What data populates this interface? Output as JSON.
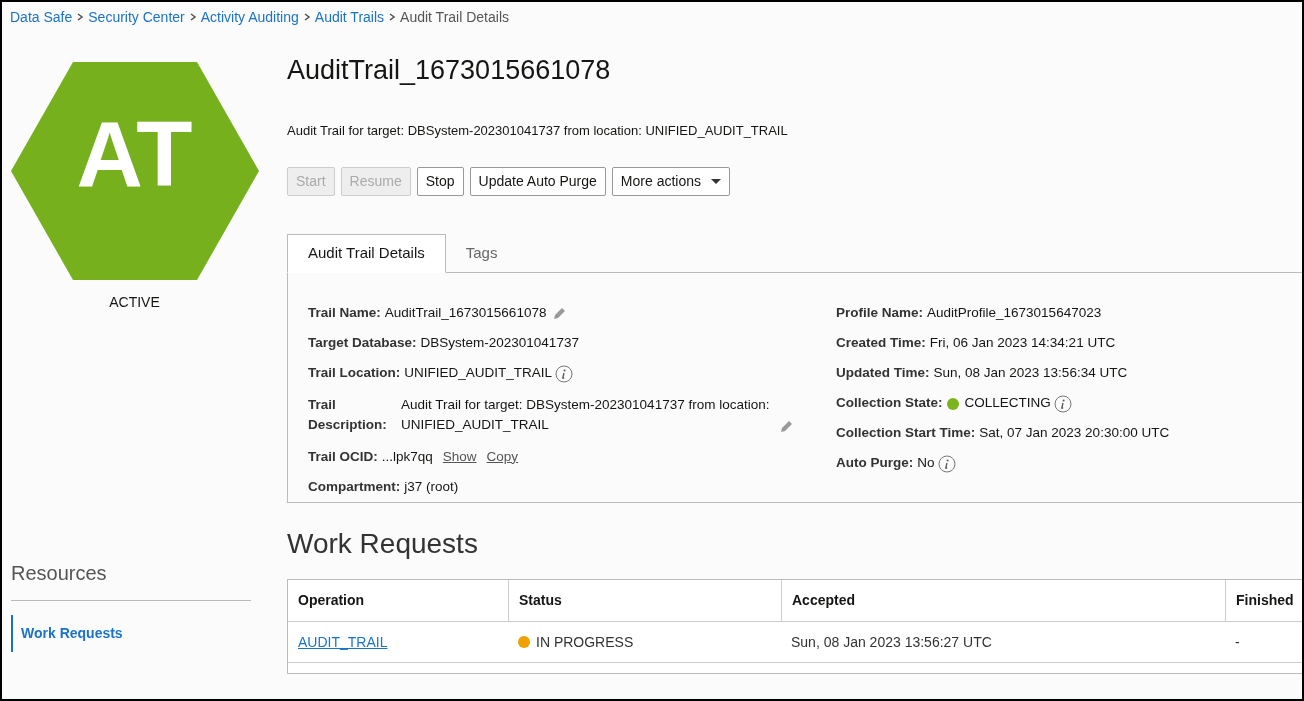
{
  "breadcrumbs": [
    {
      "label": "Data Safe",
      "link": true
    },
    {
      "label": "Security Center",
      "link": true
    },
    {
      "label": "Activity Auditing",
      "link": true
    },
    {
      "label": "Audit Trails",
      "link": true
    },
    {
      "label": "Audit Trail Details",
      "link": false
    }
  ],
  "badge": {
    "initials": "AT",
    "state": "ACTIVE"
  },
  "title": "AuditTrail_1673015661078",
  "subtitle": "Audit Trail for target: DBSystem-202301041737 from location: UNIFIED_AUDIT_TRAIL",
  "actions": [
    {
      "label": "Start",
      "disabled": true,
      "dropdown": false
    },
    {
      "label": "Resume",
      "disabled": true,
      "dropdown": false
    },
    {
      "label": "Stop",
      "disabled": false,
      "dropdown": false
    },
    {
      "label": "Update Auto Purge",
      "disabled": false,
      "dropdown": false
    },
    {
      "label": "More actions",
      "disabled": false,
      "dropdown": true
    }
  ],
  "tabs": [
    {
      "label": "Audit Trail Details",
      "selected": true
    },
    {
      "label": "Tags",
      "selected": false
    }
  ],
  "details_left": [
    {
      "kind": "inline",
      "label": "Trail Name:",
      "value": "AuditTrail_1673015661078",
      "edit": true
    },
    {
      "kind": "inline",
      "label": "Target Database:",
      "value": "DBSystem-202301041737"
    },
    {
      "kind": "inline",
      "label": "Trail Location:",
      "value": "UNIFIED_AUDIT_TRAIL",
      "info": true
    },
    {
      "kind": "wrapped",
      "label": "Trail Description:",
      "value": "Audit Trail for target: DBSystem-202301041737 from location: UNIFIED_AUDIT_TRAIL",
      "edit": true
    },
    {
      "kind": "inline",
      "label": "Trail OCID:",
      "value": "...lpk7qq",
      "links": [
        "Show",
        "Copy"
      ]
    },
    {
      "kind": "inline",
      "label": "Compartment:",
      "value": "j37 (root)"
    }
  ],
  "details_right": [
    {
      "kind": "inline",
      "label": "Profile Name:",
      "value": "AuditProfile_1673015647023"
    },
    {
      "kind": "inline",
      "label": "Created Time:",
      "value": "Fri, 06 Jan 2023 14:34:21 UTC"
    },
    {
      "kind": "inline",
      "label": "Updated Time:",
      "value": "Sun, 08 Jan 2023 13:56:34 UTC"
    },
    {
      "kind": "inline",
      "label": "Collection State:",
      "value": "COLLECTING",
      "color": "#7ab51d",
      "info": true
    },
    {
      "kind": "inline",
      "label": "Collection Start Time:",
      "value": "Sat, 07 Jan 2023 20:30:00 UTC"
    },
    {
      "kind": "inline",
      "label": "Auto Purge:",
      "value": "No",
      "info": true
    }
  ],
  "resources": {
    "title": "Resources",
    "items": [
      {
        "label": "Work Requests",
        "selected": true
      }
    ]
  },
  "work_requests": {
    "title": "Work Requests",
    "columns": [
      "Operation",
      "Status",
      "Accepted",
      "Finished"
    ],
    "rows": [
      {
        "operation": "AUDIT_TRAIL",
        "status": "IN PROGRESS",
        "color": "#f0a000",
        "accepted": "Sun, 08 Jan 2023 13:56:27 UTC",
        "finished": "-"
      }
    ]
  }
}
